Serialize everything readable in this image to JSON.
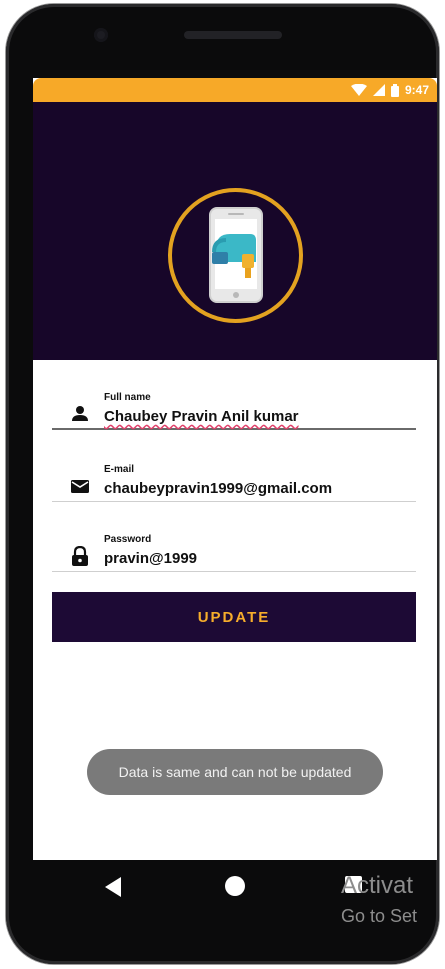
{
  "status_bar": {
    "time": "9:47",
    "icons": [
      "wifi-icon",
      "signal-icon",
      "battery-icon"
    ],
    "color": "#f7a928"
  },
  "header": {
    "background": "#170629",
    "logo_icon": "phone-lock-logo-icon"
  },
  "form": {
    "full_name": {
      "label": "Full name",
      "value": "Chaubey Pravin Anil kumar",
      "icon": "person-icon"
    },
    "email": {
      "label": "E-mail",
      "value": "chaubeypravin1999@gmail.com",
      "icon": "mail-icon"
    },
    "password": {
      "label": "Password",
      "value": "pravin@1999",
      "icon": "lock-icon"
    }
  },
  "update_button": {
    "label": "UPDATE"
  },
  "toast": {
    "message": "Data is same and can not be updated"
  },
  "navigation": {
    "icons": [
      "back-icon",
      "home-icon",
      "recent-apps-icon"
    ]
  },
  "watermark": {
    "line1": "Activat",
    "line2": "Go to Set"
  },
  "colors": {
    "accent": "#f6ad2b",
    "button": "#1d0a35"
  }
}
